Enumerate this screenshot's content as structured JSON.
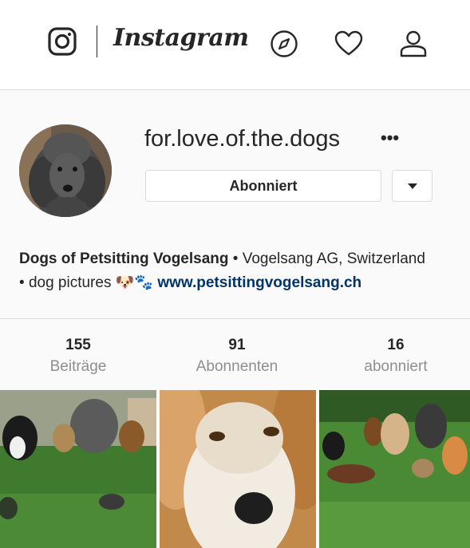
{
  "header": {
    "brand": "Instagram",
    "icons": [
      "instagram-glyph-icon",
      "compass-icon",
      "heart-icon",
      "user-icon"
    ]
  },
  "profile": {
    "username": "for.love.of.the.dogs",
    "more_label": "•••",
    "follow_label": "Abonniert",
    "bio": {
      "name": "Dogs of Petsitting Vogelsang",
      "sep1": "•",
      "location": "Vogelsang AG, Switzerland",
      "sep2": "•",
      "text": "dog pictures",
      "emoji": "🐶🐾",
      "link": "www.petsittingvogelsang.ch"
    }
  },
  "stats": [
    {
      "value": "155",
      "label": "Beiträge"
    },
    {
      "value": "91",
      "label": "Abonnenten"
    },
    {
      "value": "16",
      "label": "abonniert"
    }
  ],
  "colors": {
    "link": "#003569",
    "muted": "#8e8e8e",
    "border": "#dbdbdb",
    "background": "#fafafa"
  }
}
